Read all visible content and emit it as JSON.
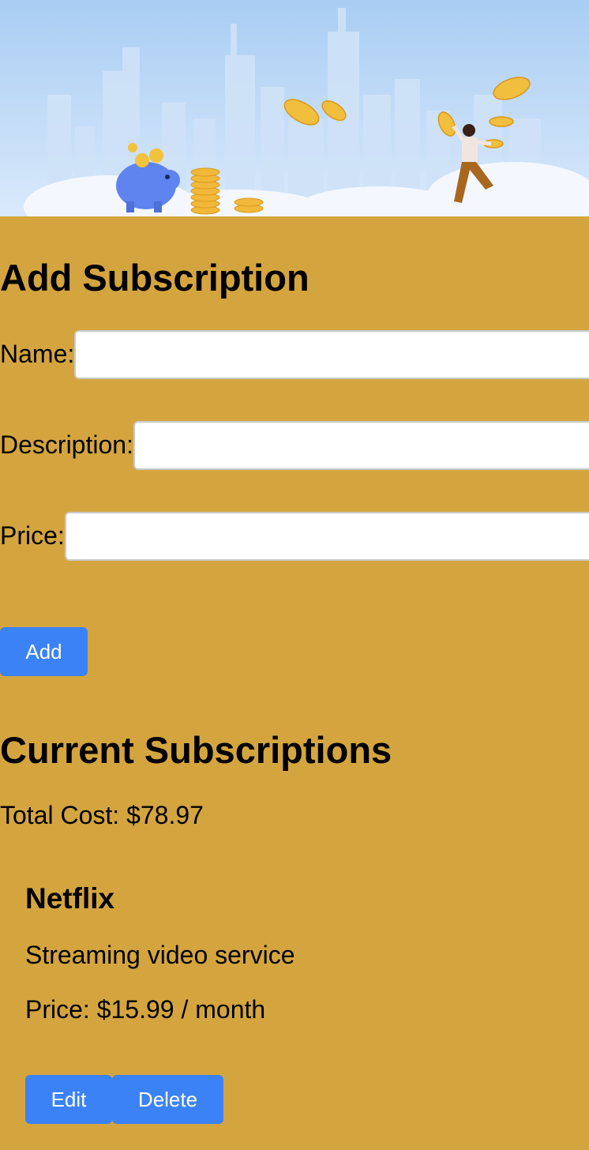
{
  "add_form": {
    "heading": "Add Subscription",
    "name_label": "Name:",
    "name_value": "",
    "description_label": "Description:",
    "description_value": "",
    "price_label": "Price:",
    "price_value": "",
    "add_button": "Add"
  },
  "current": {
    "heading": "Current Subscriptions",
    "total_cost": "Total Cost: $78.97",
    "subscriptions": [
      {
        "name": "Netflix",
        "description": "Streaming video service",
        "price": "Price: $15.99 / month",
        "edit_button": "Edit",
        "delete_button": "Delete"
      }
    ]
  },
  "colors": {
    "page_background": "#d4a53f",
    "button": "#3b82f6",
    "banner_sky": "#b9d7f6"
  }
}
